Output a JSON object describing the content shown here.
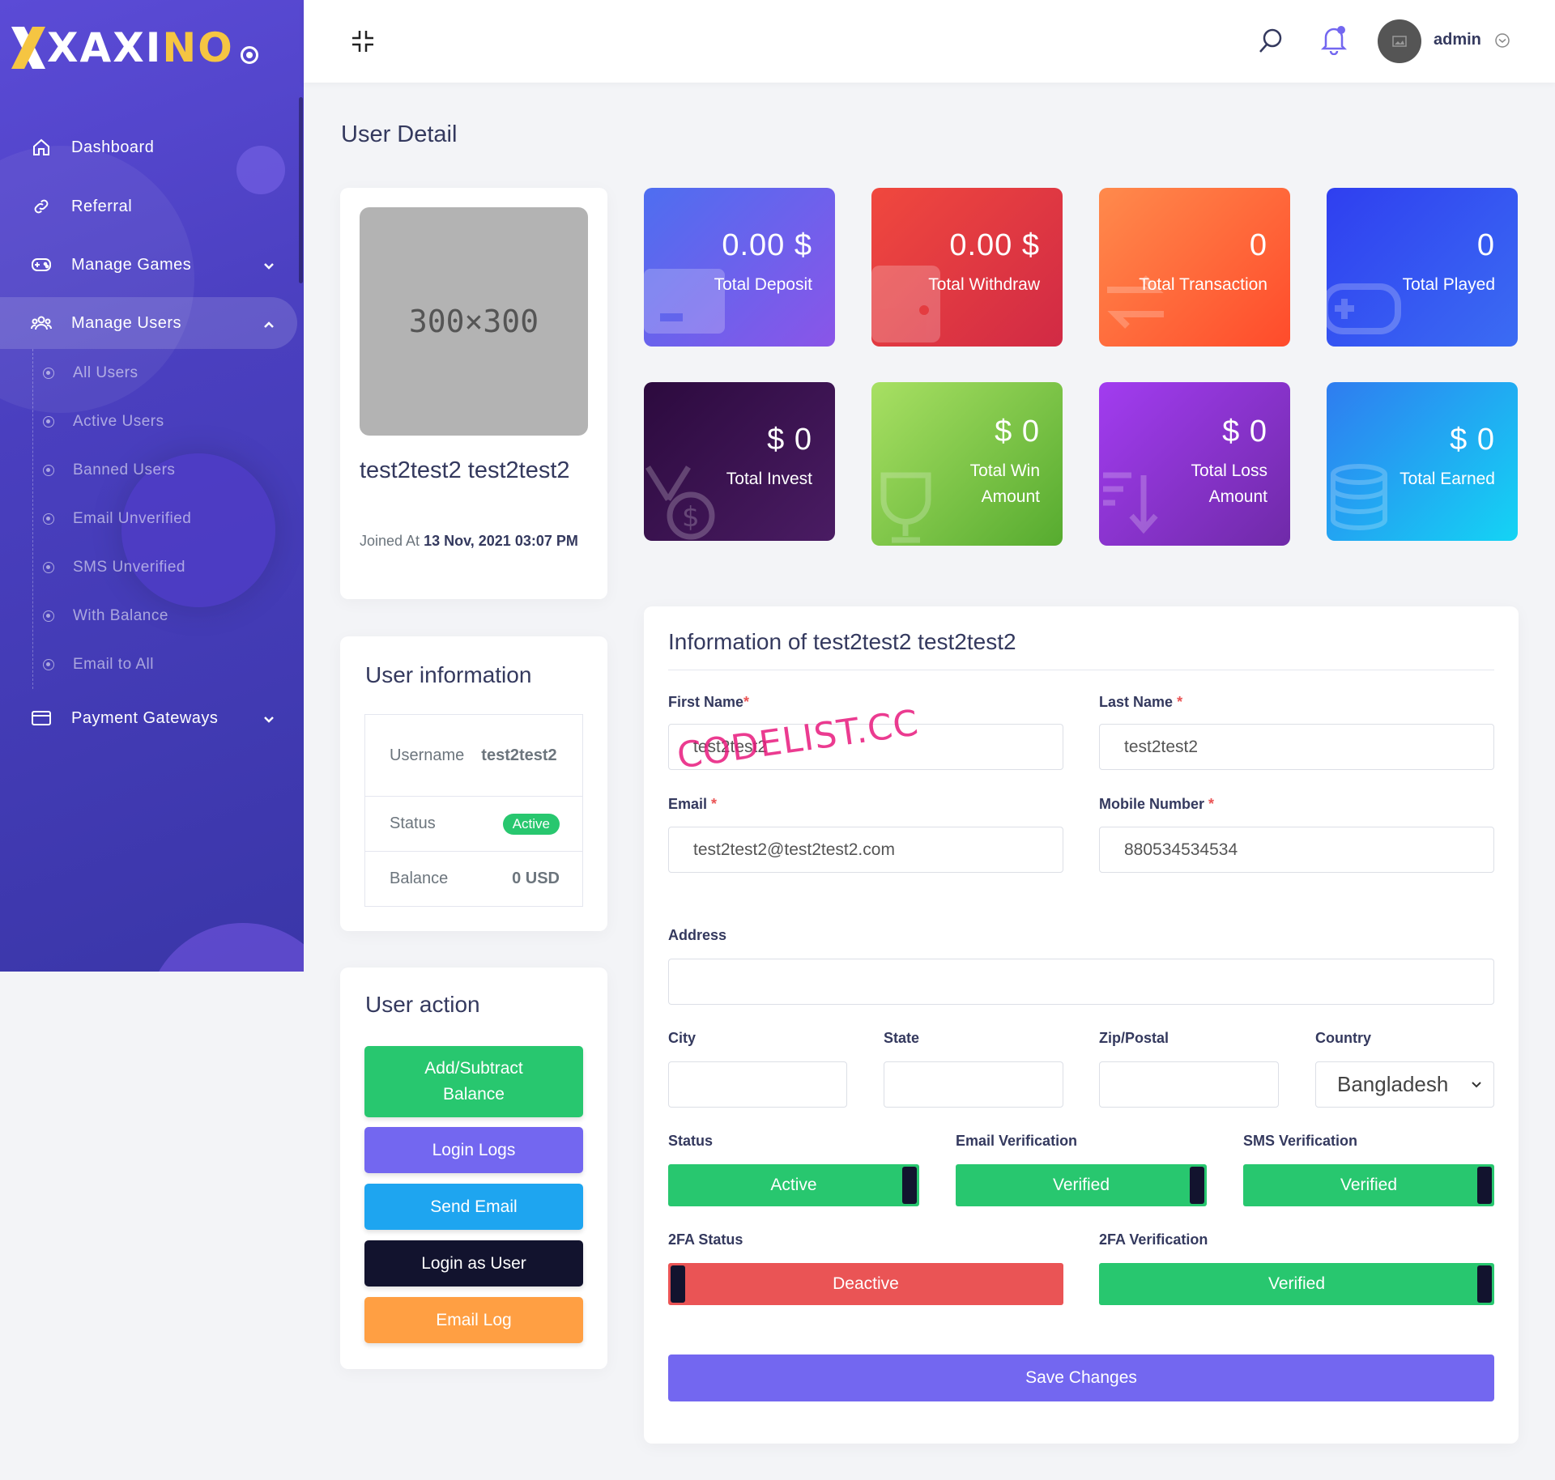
{
  "brand": {
    "logo_text": "XAXINO"
  },
  "sidebar": {
    "items": [
      {
        "label": "Dashboard"
      },
      {
        "label": "Referral"
      },
      {
        "label": "Manage Games"
      },
      {
        "label": "Manage Users"
      },
      {
        "label": "Payment Gateways"
      }
    ],
    "sub_items": [
      {
        "label": "All Users"
      },
      {
        "label": "Active Users"
      },
      {
        "label": "Banned Users"
      },
      {
        "label": "Email Unverified"
      },
      {
        "label": "SMS Unverified"
      },
      {
        "label": "With Balance"
      },
      {
        "label": "Email to All"
      }
    ]
  },
  "topbar": {
    "username": "admin"
  },
  "page": {
    "title": "User Detail"
  },
  "profile": {
    "placeholder": "300×300",
    "full_name": "test2test2 test2test2",
    "joined_label": "Joined At",
    "joined_value": "13 Nov, 2021 03:07 PM"
  },
  "stats": [
    {
      "value": "0.00 $",
      "label": "Total Deposit",
      "color1": "#4e6ef0",
      "color2": "#8a55e8"
    },
    {
      "value": "0.00 $",
      "label": "Total Withdraw",
      "color1": "#f0483e",
      "color2": "#d12a45"
    },
    {
      "value": "0",
      "label": "Total Transaction",
      "color1": "#ff8a4c",
      "color2": "#ff4b2b"
    },
    {
      "value": "0",
      "label": "Total Played",
      "color1": "#2f3ff0",
      "color2": "#3b6cf3"
    },
    {
      "value": "$ 0",
      "label": "Total Invest",
      "color1": "#2c0a3e",
      "color2": "#4a1c63"
    },
    {
      "value": "$ 0",
      "label": "Total Win Amount",
      "color1": "#a8e063",
      "color2": "#56ab2f"
    },
    {
      "value": "$ 0",
      "label": "Total Loss Amount",
      "color1": "#a23cf0",
      "color2": "#6f2aa8"
    },
    {
      "value": "$ 0",
      "label": "Total Earned",
      "color1": "#2f7cf0",
      "color2": "#14d4f4"
    }
  ],
  "user_info": {
    "title": "User information",
    "username_label": "Username",
    "username_value": "test2test2",
    "status_label": "Status",
    "status_value": "Active",
    "balance_label": "Balance",
    "balance_value": "0 USD"
  },
  "user_action": {
    "title": "User action",
    "buttons": [
      {
        "label": "Add/Subtract Balance",
        "color": "#28c76f"
      },
      {
        "label": "Login Logs",
        "color": "#7367f0"
      },
      {
        "label": "Send Email",
        "color": "#1ea5f0"
      },
      {
        "label": "Login as User",
        "color": "#12132e"
      },
      {
        "label": "Email Log",
        "color": "#ff9f43"
      }
    ]
  },
  "form": {
    "title": "Information of test2test2 test2test2",
    "first_name_label": "First Name",
    "first_name": "test2test2",
    "last_name_label": "Last Name",
    "last_name": "test2test2",
    "email_label": "Email",
    "email": "test2test2@test2test2.com",
    "mobile_label": "Mobile Number",
    "mobile": "880534534534",
    "address_label": "Address",
    "address": "",
    "city_label": "City",
    "state_label": "State",
    "zip_label": "Zip/Postal",
    "country_label": "Country",
    "country": "Bangladesh",
    "status_label": "Status",
    "status": "Active",
    "email_verif_label": "Email Verification",
    "email_verif": "Verified",
    "sms_verif_label": "SMS Verification",
    "sms_verif": "Verified",
    "twofa_status_label": "2FA Status",
    "twofa_status": "Deactive",
    "twofa_verif_label": "2FA Verification",
    "twofa_verif": "Verified",
    "save_label": "Save Changes"
  },
  "watermark": "CODELIST.CC",
  "colors": {
    "accent": "#7367f0",
    "success": "#28c76f",
    "danger": "#ea5455",
    "dark": "#12132e"
  }
}
